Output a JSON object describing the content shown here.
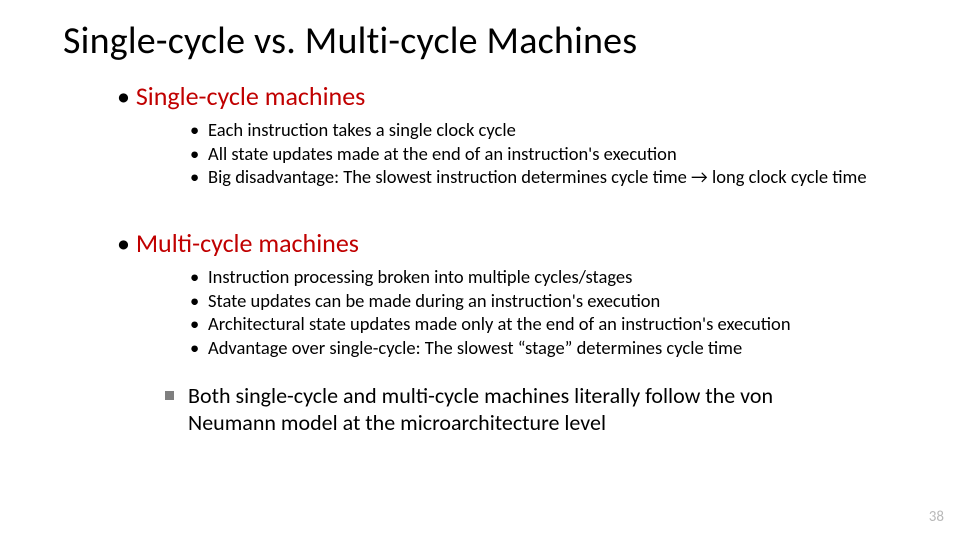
{
  "title": "Single-cycle vs. Multi-cycle Machines",
  "sec1": {
    "heading": "Single-cycle machines",
    "b1": "Each instruction takes a single clock cycle",
    "b2": "All state updates made at the end of an instruction's execution",
    "b3": "Big disadvantage: The slowest instruction determines cycle time → long clock cycle time"
  },
  "sec2": {
    "heading": "Multi-cycle machines",
    "b1": "Instruction processing broken into multiple cycles/stages",
    "b2": "State updates can be made during an instruction's execution",
    "b3": "Architectural state updates made only at the end of an instruction's execution",
    "b4": "Advantage over single-cycle: The slowest “stage” determines cycle time"
  },
  "conclusion": "Both single-cycle and multi-cycle machines literally follow the von Neumann model at the microarchitecture level",
  "page": "38"
}
